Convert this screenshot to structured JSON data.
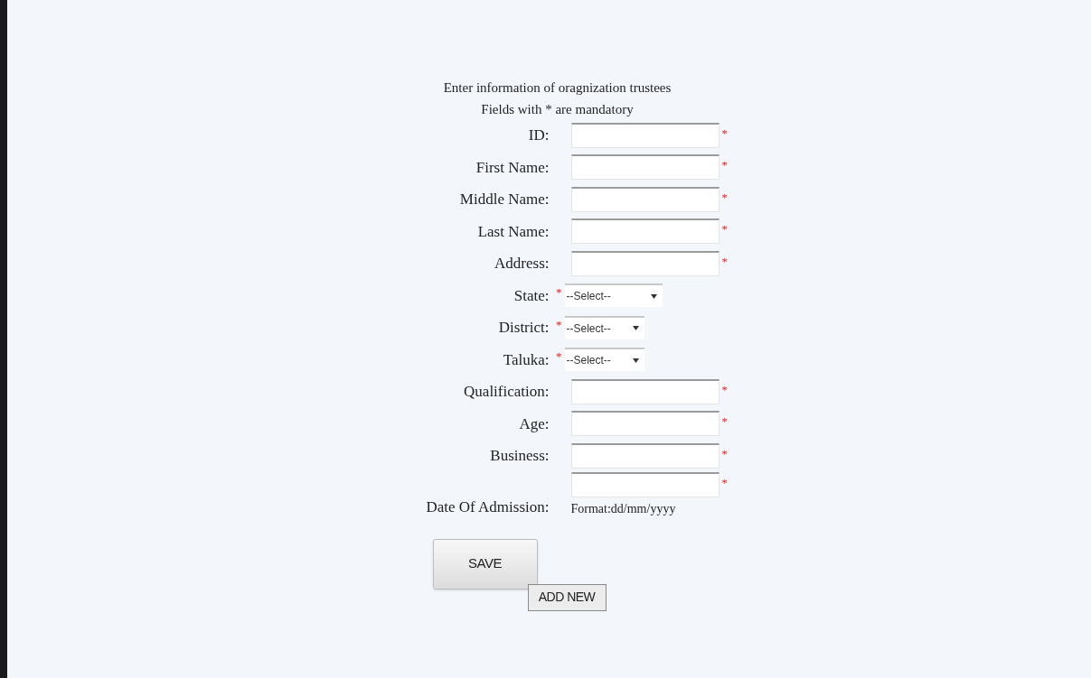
{
  "heading": "Enter information of oragnization trustees",
  "note": "Fields with * are mandatory",
  "fields": [
    {
      "kind": "text",
      "label": "ID:",
      "marker": "*"
    },
    {
      "kind": "text",
      "label": "First Name:",
      "marker": "*"
    },
    {
      "kind": "text",
      "label": "Middle Name:",
      "marker": "*"
    },
    {
      "kind": "text",
      "label": "Last Name:",
      "marker": "*"
    },
    {
      "kind": "text",
      "label": "Address:",
      "marker": "*"
    },
    {
      "kind": "select",
      "label": "State:",
      "marker": "*",
      "value": "--Select--",
      "wide": true
    },
    {
      "kind": "select",
      "label": "District:",
      "marker": "*",
      "value": "--Select--",
      "wide": false
    },
    {
      "kind": "select",
      "label": "Taluka:",
      "marker": "*",
      "value": "--Select--",
      "wide": false
    },
    {
      "kind": "text",
      "label": "Qualification:",
      "marker": "*"
    },
    {
      "kind": "text",
      "label": "Age:",
      "marker": "*"
    },
    {
      "kind": "text",
      "label": "Business:",
      "marker": "*"
    },
    {
      "kind": "text",
      "label": "Date Of Admission:",
      "marker": "*",
      "hint": "Format:dd/mm/yyyy"
    }
  ],
  "buttons": [
    {
      "kind": "large",
      "label": "SAVE"
    },
    {
      "kind": "small",
      "label": "ADD NEW"
    }
  ]
}
